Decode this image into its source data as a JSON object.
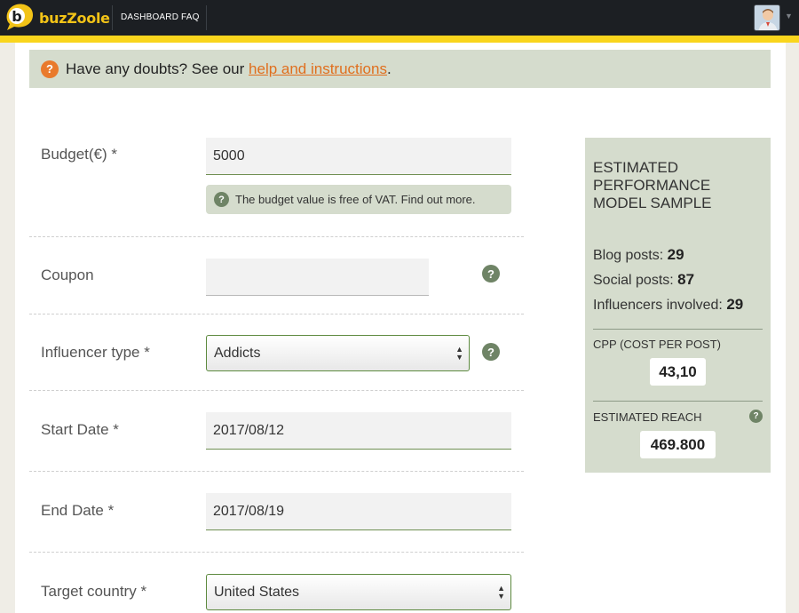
{
  "app": {
    "logo_text": "buzZoole"
  },
  "nav": {
    "dashboard": "DASHBOARD",
    "faq": "FAQ"
  },
  "banner": {
    "text_before": "Have any doubts? See our ",
    "link": "help and instructions",
    "text_after": "."
  },
  "form": {
    "budget": {
      "label": "Budget(€) *",
      "value": "5000",
      "hint": "The budget value is free of VAT. Find out more."
    },
    "coupon": {
      "label": "Coupon",
      "value": ""
    },
    "influencer_type": {
      "label": "Influencer type *",
      "selected": "Addicts"
    },
    "start_date": {
      "label": "Start Date *",
      "value": "2017/08/12"
    },
    "end_date": {
      "label": "End Date *",
      "value": "2017/08/19"
    },
    "target_country": {
      "label": "Target country *",
      "selected": "United States"
    }
  },
  "estimate": {
    "title": "ESTIMATED PERFORMANCE MODEL SAMPLE",
    "blog_posts_label": "Blog posts:",
    "blog_posts": "29",
    "social_posts_label": "Social posts:",
    "social_posts": "87",
    "influencers_label": "Influencers involved:",
    "influencers": "29",
    "cpp_label": "CPP (COST PER POST)",
    "cpp_value": "43,10",
    "reach_label": "ESTIMATED REACH",
    "reach_value": "469.800"
  },
  "colors": {
    "accent_orange": "#e06f1e",
    "brand_yellow": "#f9d51d",
    "panel_green": "#d5dccd",
    "field_border": "#6f8f52"
  },
  "icons": [
    "logo-icon",
    "question-icon",
    "avatar-icon",
    "caret-down-icon",
    "select-arrows-icon"
  ]
}
